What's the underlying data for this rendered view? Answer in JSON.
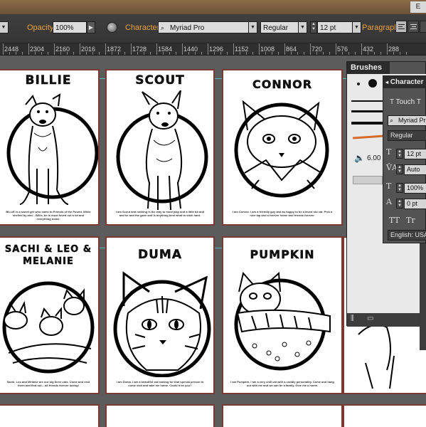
{
  "window": {
    "top_tag": "E"
  },
  "control_bar": {
    "opacity_label": "Opacity:",
    "opacity_value": "100%",
    "character_label": "Character:",
    "font_family": "Myriad Pro",
    "font_style": "Regular",
    "font_size": "12 pt",
    "paragraph_label": "Paragraph:"
  },
  "ruler": {
    "ticks": [
      "2448",
      "2304",
      "2160",
      "2016",
      "1872",
      "1728",
      "1584",
      "1440",
      "1296",
      "1152",
      "1008",
      "864",
      "720",
      "576",
      "432",
      "288"
    ]
  },
  "artboards": [
    {
      "name": "BILLIE",
      "caption": "BILLIE is a sweet girl who came to Friends of the Pound. While shelled by and... Billie, be is most loved out a lot and everything home."
    },
    {
      "name": "SCOUT",
      "caption": "I am Scout and nothing is the way to most play and a little bit and and be and the gave and is anything best what to stick hard."
    },
    {
      "name": "CONNOR",
      "caption": "I am Connor. I am a friendly guy and as happy to be a loved old cat. Pick a nice lap and a forever home and friends forever."
    },
    {
      "name": "SACHI & LEO & MELANIE",
      "caption": "Sachi, Leo and Melanie are our big three cats. Come and visit them and find out... all friends forever loving!"
    },
    {
      "name": "DUMA",
      "caption": "I am Duma. I am a beautiful cat looking for that special person to come visit and take me home. Could it be you?"
    },
    {
      "name": "PUMPKIN",
      "caption": "I am Pumpkin. I am a very chill cat with a cuddly personality. Come and hang out with me and we can be a family. Give me a home."
    }
  ],
  "brushes_panel": {
    "title": "Brushes",
    "brush_size": "6.00"
  },
  "character_panel": {
    "title": "Character",
    "search_text": "Touch T",
    "font_family": "Myriad Pro",
    "font_style": "Regular",
    "font_size": "12 pt",
    "leading": "Auto",
    "scale": "100%",
    "baseline": "0 pt",
    "language": "English: USA",
    "tt_label": "TT",
    "tr_label": "Tr"
  },
  "colors": {
    "accent_label": "#e9a23b",
    "artboard_border": "#7a3a32",
    "guide": "#5ee0e8",
    "canvas": "#5c5c5c",
    "panel_bg": "#535353"
  }
}
